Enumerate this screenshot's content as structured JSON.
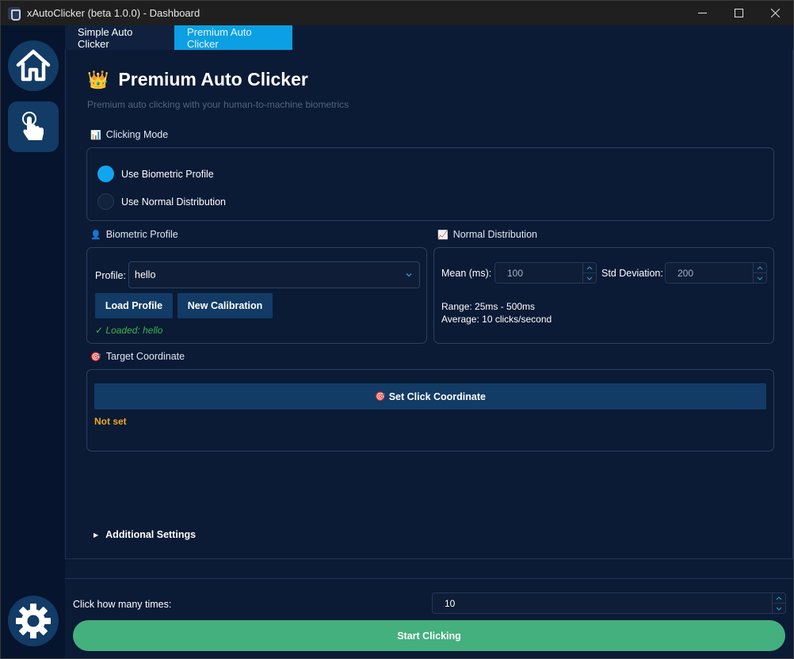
{
  "window": {
    "title": "xAutoClicker (beta 1.0.0) - Dashboard"
  },
  "tabs": [
    {
      "label": "Simple Auto Clicker",
      "active": false
    },
    {
      "label": "Premium Auto Clicker",
      "active": true
    }
  ],
  "header": {
    "icon": "👑",
    "title": "Premium Auto Clicker",
    "subtitle": "Premium auto clicking with your human-to-machine biometrics"
  },
  "clicking_mode": {
    "icon": "📊",
    "label": "Clicking Mode",
    "options": [
      {
        "label": "Use Biometric Profile",
        "selected": true
      },
      {
        "label": "Use Normal Distribution",
        "selected": false
      }
    ]
  },
  "biometric": {
    "icon": "👤",
    "label": "Biometric Profile",
    "profile_label": "Profile:",
    "profile_value": "hello",
    "load_button": "Load Profile",
    "calibration_button": "New Calibration",
    "status": "✓ Loaded: hello"
  },
  "normal_distribution": {
    "icon": "📈",
    "label": "Normal Distribution",
    "mean_label": "Mean (ms):",
    "mean_value": "100",
    "std_label": "Std Deviation:",
    "std_value": "200",
    "range_text": "Range: 25ms - 500ms",
    "average_text": "Average: 10 clicks/second"
  },
  "target": {
    "icon": "🎯",
    "label": "Target Coordinate",
    "button_icon": "🎯",
    "button_label": "Set Click Coordinate",
    "status": "Not set"
  },
  "additional_settings": {
    "label": "Additional Settings"
  },
  "bottom": {
    "click_count_label": "Click how many times:",
    "click_count_value": "10",
    "start_button": "Start Clicking"
  },
  "sidebar": {
    "items": [
      {
        "icon": "home-icon"
      },
      {
        "icon": "pointer-hand-icon"
      },
      {
        "icon": "gear-icon"
      }
    ]
  },
  "colors": {
    "accent": "#0aa0e3",
    "button": "#123b66",
    "start": "#43b07e",
    "success": "#39b54a",
    "warning": "#f0a81e"
  }
}
